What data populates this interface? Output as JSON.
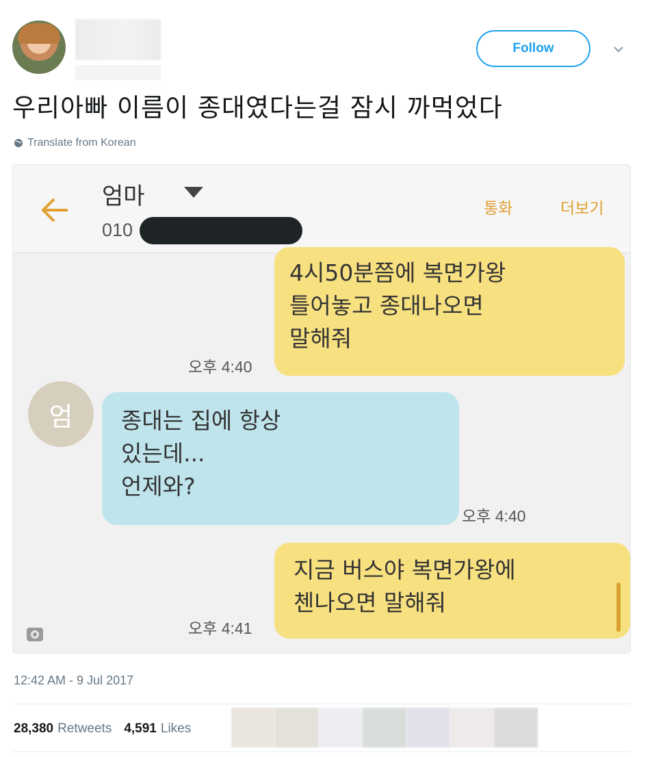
{
  "tweet": {
    "follow_label": "Follow",
    "text": "우리아빠 이름이 종대였다는걸 잠시 까먹었다",
    "translate_label": "Translate from Korean",
    "timestamp": "12:42 AM - 9 Jul 2017",
    "retweets_count": "28,380",
    "retweets_label": "Retweets",
    "likes_count": "4,591",
    "likes_label": "Likes"
  },
  "chat": {
    "contact_name": "엄마",
    "number_prefix": "010",
    "call_label": "통화",
    "more_label": "더보기",
    "contact_avatar_char": "엄",
    "messages": [
      {
        "from": "me",
        "text": "4시50분쯤에 복면가왕\n틀어놓고 종대나오면\n말해줘",
        "time": "오후 4:40"
      },
      {
        "from": "them",
        "text": "종대는 집에 항상\n있는데...\n언제와?",
        "time": "오후 4:40"
      },
      {
        "from": "me",
        "text": "지금 버스야 복면가왕에\n첸나오면 말해줘",
        "time": "오후 4:41"
      }
    ]
  },
  "colors": {
    "accent": "#1da1f2",
    "my_bubble": "#f7e07f",
    "their_bubble": "#bfe4ec",
    "chat_accent": "#e0a030"
  }
}
